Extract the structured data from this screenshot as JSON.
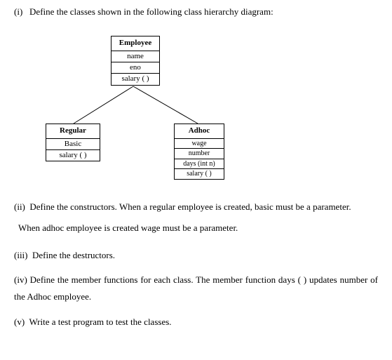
{
  "items": {
    "i_label": "(i)",
    "i_text": "Define the classes shown in the following class hierarchy diagram:",
    "ii_label": "(ii)",
    "ii_text": "Define  the  constructors.  When  a  regular  employee  is  created,  basic  must  be  a parameter.",
    "ii_sub": "When adhoc employee is created wage must be a parameter.",
    "iii_label": "(iii)",
    "iii_text": "Define the destructors.",
    "iv_label": "(iv)",
    "iv_text": "Define the member functions for each class. The member function days ( ) updates number of the Adhoc employee.",
    "v_label": "(v)",
    "v_text": "Write a test program to test the classes."
  },
  "chart_data": {
    "type": "diagram",
    "description": "UML class hierarchy diagram",
    "classes": [
      {
        "name": "Employee",
        "attributes": [
          "name",
          "eno"
        ],
        "methods": [
          "salary ( )"
        ],
        "parent": null
      },
      {
        "name": "Regular",
        "attributes": [
          "Basic"
        ],
        "methods": [
          "salary ( )"
        ],
        "parent": "Employee"
      },
      {
        "name": "Adhoc",
        "attributes": [
          "wage",
          "number"
        ],
        "methods": [
          "days (int n)",
          "salary ( )"
        ],
        "parent": "Employee"
      }
    ]
  }
}
